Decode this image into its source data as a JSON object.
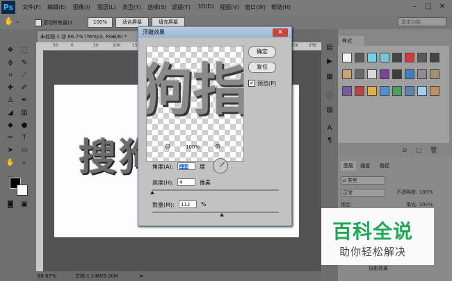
{
  "menubar": {
    "logo": "Ps",
    "items": [
      "文件(F)",
      "编辑(E)",
      "图像(I)",
      "图层(L)",
      "类型(Y)",
      "选择(S)",
      "滤镜(T)",
      "3D(D)",
      "视图(V)",
      "窗口(W)",
      "帮助(H)"
    ],
    "window_controls": [
      "–",
      "□",
      "✕"
    ]
  },
  "options": {
    "scroll_all_label": "滚动所有窗口",
    "zoom_button": "100%",
    "fit_screen": "适合屏幕",
    "fill_screen": "填充屏幕",
    "workspace": "基本功能"
  },
  "document": {
    "tab_title": "未标题-1 @ 66.7% (Temp3, RGB/8) *",
    "ruler_ticks": [
      "50",
      "0",
      "50",
      "100",
      "150",
      "200",
      "250"
    ],
    "canvas_text": "搜狗",
    "status_zoom": "66.67%",
    "status_doc": "文档:1.14M/5.00M"
  },
  "dialog": {
    "title": "浮雕效果",
    "close": "✕",
    "preview_text": "狗指",
    "ok": "确定",
    "reset": "复位",
    "preview_label": "预览(P)",
    "preview_checked": "✔",
    "zoom_out": "⊖",
    "zoom_value": "100%",
    "zoom_in": "⊕",
    "angle_label": "角度(A):",
    "angle_value": "133",
    "angle_unit": "度",
    "height_label": "高度(H):",
    "height_value": "4",
    "height_unit": "像素",
    "amount_label": "数量(M):",
    "amount_value": "112",
    "amount_unit": "%",
    "height_slider": 0.0,
    "amount_slider": 0.55
  },
  "styles_panel": {
    "tab": "样式",
    "swatch_colors": [
      "#f4f4f4",
      "#5a5a5a",
      "#6fd3e6",
      "#74c9d9",
      "#444444",
      "#d23b3b",
      "#5a5a5a",
      "#444444",
      "#c8a36f",
      "#6a6a6a",
      "#d8d8d8",
      "#7f3fa0",
      "#3d3d3d",
      "#3a7fc0",
      "#8c8c8c",
      "#a09070",
      "#7a5aa0",
      "#c04040",
      "#e0b040",
      "#5090d0",
      "#4aa060",
      "#6080b0",
      "#a0d0f0",
      "#c09060"
    ]
  },
  "layers_panel": {
    "tabs": [
      "图层",
      "通道",
      "路径"
    ],
    "kind_label": "ρ 类型",
    "blend_mode": "正常",
    "opacity_label": "不透明度: 100%",
    "lock_label": "锁定:",
    "fill_label": "填充: 100%",
    "layer_name": "投影效果"
  },
  "watermark": {
    "title": "百科全说",
    "subtitle": "助你轻松解决"
  }
}
